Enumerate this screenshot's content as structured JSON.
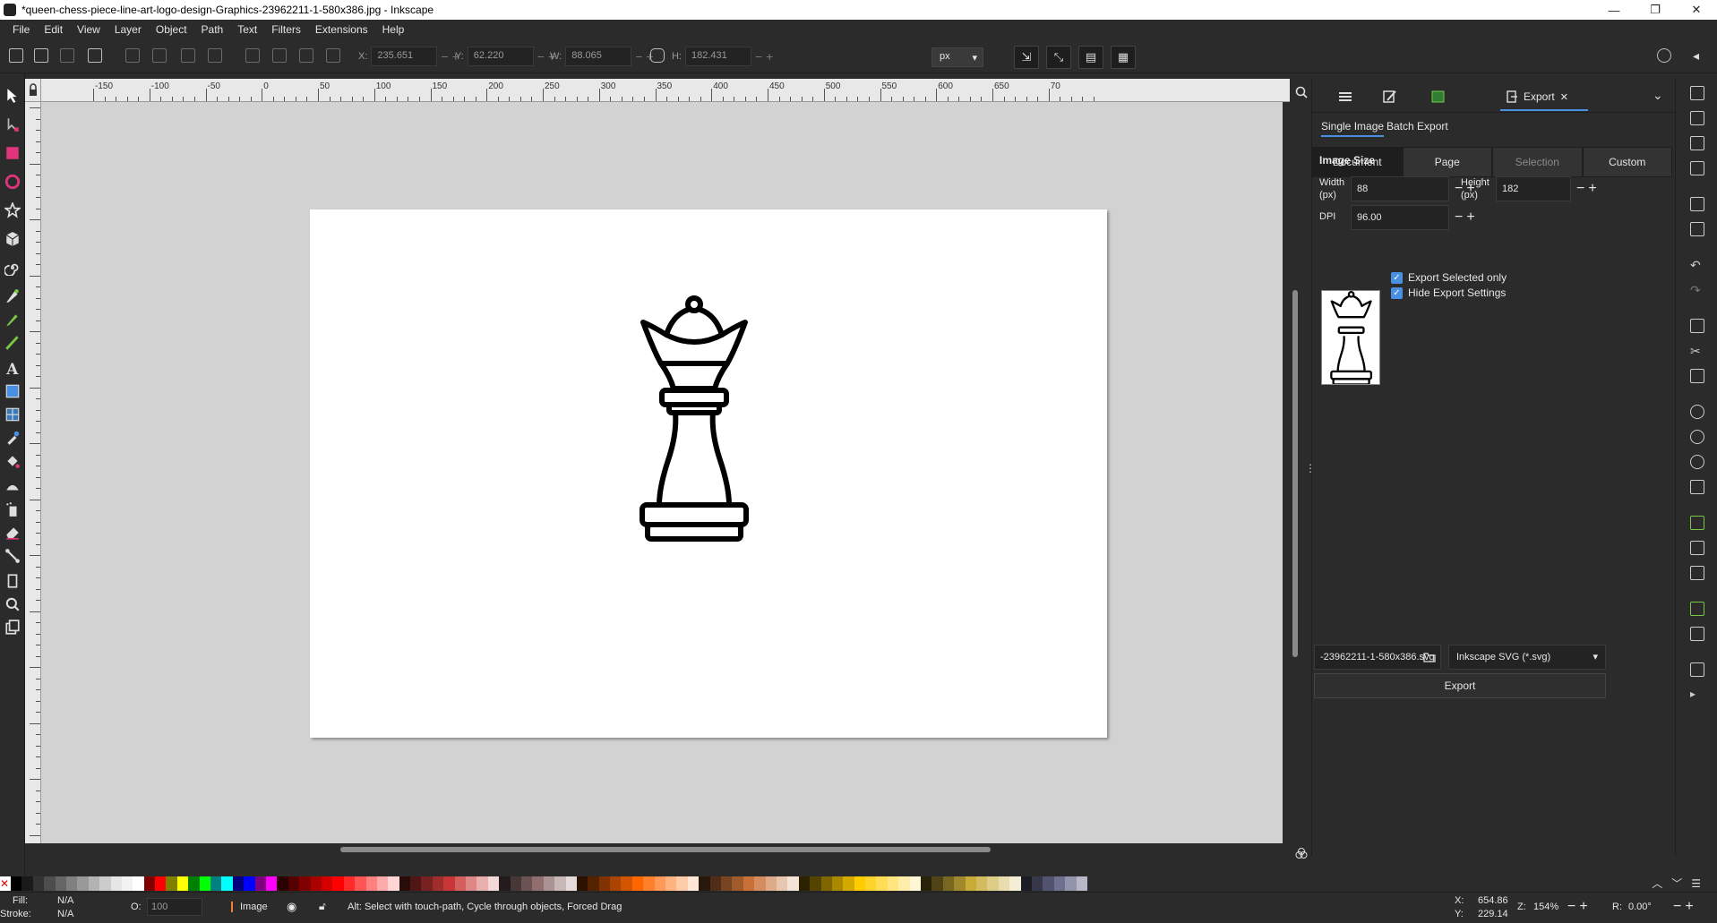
{
  "window": {
    "title": "*queen-chess-piece-line-art-logo-design-Graphics-23962211-1-580x386.jpg - Inkscape",
    "minimize": "—",
    "maximize": "❐",
    "close": "✕"
  },
  "menu": [
    "File",
    "Edit",
    "View",
    "Layer",
    "Object",
    "Path",
    "Text",
    "Filters",
    "Extensions",
    "Help"
  ],
  "toolbar": {
    "x_label": "X:",
    "x_value": "235.651",
    "y_label": "Y:",
    "y_value": "62.220",
    "w_label": "W:",
    "w_value": "88.065",
    "h_label": "H:",
    "h_value": "182.431",
    "unit": "px"
  },
  "ruler": {
    "labels": [
      "-150",
      "-100",
      "-50",
      "0",
      "50",
      "100",
      "150",
      "200",
      "250",
      "300",
      "350",
      "400",
      "450",
      "500",
      "550",
      "600",
      "650",
      "70"
    ]
  },
  "dock": {
    "export_tab_label": "Export",
    "subtabs": [
      "Single Image",
      "Batch Export"
    ],
    "areas": [
      "Document",
      "Page",
      "Selection",
      "Custom"
    ],
    "image_size_title": "Image Size",
    "width_label": "Width",
    "width_unit": "(px)",
    "width_value": "88",
    "height_label": "Height",
    "height_unit": "(px)",
    "height_value": "182",
    "dpi_label": "DPI",
    "dpi_value": "96.00",
    "export_selected_only": "Export Selected only",
    "hide_export_settings": "Hide Export Settings",
    "filename": "-23962211-1-580x386.svg",
    "format": "Inkscape SVG (*.svg)",
    "export_button": "Export"
  },
  "status": {
    "fill_label": "Fill:",
    "fill_value": "N/A",
    "stroke_label": "Stroke:",
    "stroke_value": "N/A",
    "opacity_label": "O:",
    "opacity_value": "100",
    "layer": "Image",
    "message": "Alt: Select with touch-path, Cycle through objects, Forced Drag",
    "cursor_x_label": "X:",
    "cursor_x": "654.86",
    "cursor_y_label": "Y:",
    "cursor_y": "229.14",
    "zoom_label": "Z:",
    "zoom": "154%",
    "rotation_label": "R:",
    "rotation": "0.00°"
  },
  "colors": {
    "accent": "#4a90e2",
    "panel_bg": "#2b2b2b",
    "canvas_bg": "#d2d2d2"
  }
}
